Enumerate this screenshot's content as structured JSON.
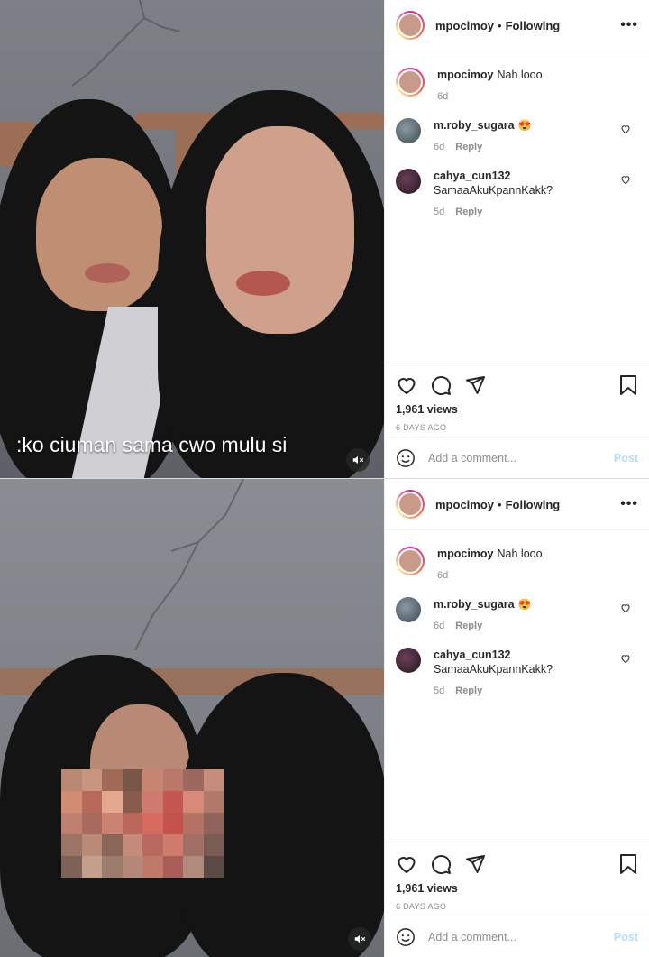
{
  "panels": [
    {
      "overlay_caption": ":ko ciuman sama cwo mulu si",
      "header": {
        "username": "mpocimoy",
        "separator": "•",
        "follow_status": "Following",
        "more": "•••"
      },
      "caption_comment": {
        "username": "mpocimoy",
        "text": "Nah looo",
        "age": "6d"
      },
      "comments": [
        {
          "username": "m.roby_sugara",
          "text": "😍",
          "age": "6d",
          "reply": "Reply"
        },
        {
          "username": "cahya_cun132",
          "text": "SamaaAkuKpannKakk?",
          "age": "5d",
          "reply": "Reply"
        }
      ],
      "views": "1,961 views",
      "date": "6 DAYS AGO",
      "add_comment_placeholder": "Add a comment...",
      "post_button": "Post"
    },
    {
      "header": {
        "username": "mpocimoy",
        "separator": "•",
        "follow_status": "Following",
        "more": "•••"
      },
      "caption_comment": {
        "username": "mpocimoy",
        "text": "Nah looo",
        "age": "6d"
      },
      "comments": [
        {
          "username": "m.roby_sugara",
          "text": "😍",
          "age": "6d",
          "reply": "Reply"
        },
        {
          "username": "cahya_cun132",
          "text": "SamaaAkuKpannKakk?",
          "age": "5d",
          "reply": "Reply"
        }
      ],
      "views": "1,961 views",
      "date": "6 DAYS AGO",
      "add_comment_placeholder": "Add a comment...",
      "post_button": "Post"
    }
  ],
  "icons": {
    "mute": "muted-speaker-icon",
    "like": "heart-icon",
    "comment": "comment-bubble-icon",
    "share": "paper-plane-icon",
    "save": "bookmark-icon",
    "emoji": "smiley-icon"
  },
  "colors": {
    "text": "#262626",
    "secondary": "#8e8e8e",
    "post_button_disabled": "#b2dffc",
    "border": "#efefef"
  }
}
